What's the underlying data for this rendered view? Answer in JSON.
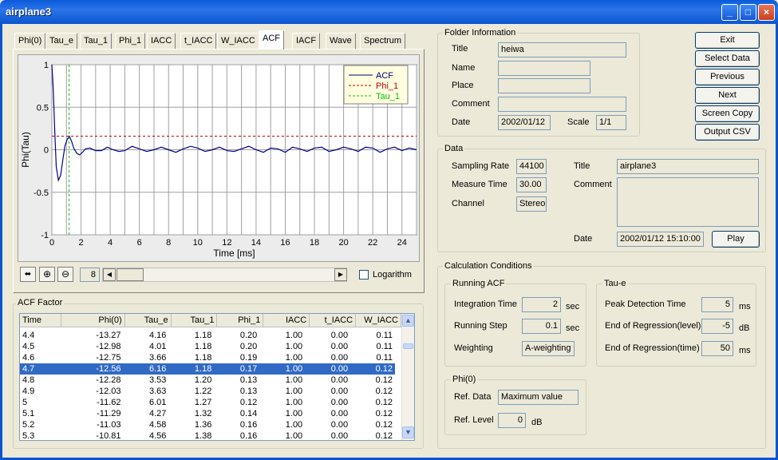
{
  "window": {
    "title": "airplane3"
  },
  "tabs": [
    "Phi(0)",
    "Tau_e",
    "Tau_1",
    "Phi_1",
    "IACC",
    "t_IACC",
    "W_IACC",
    "ACF",
    "IACF",
    "Wave",
    "Spectrum"
  ],
  "selected_tab": "ACF",
  "chart_data": {
    "type": "line",
    "xlabel": "Time [ms]",
    "ylabel": "Phi(Tau)",
    "xlim": [
      0,
      25
    ],
    "ylim": [
      -1,
      1
    ],
    "xticks": [
      0,
      2,
      4,
      6,
      8,
      10,
      12,
      14,
      16,
      18,
      20,
      22,
      24
    ],
    "yticks": [
      1,
      0.5,
      0,
      -0.5,
      -1
    ],
    "ytick_labels": [
      "1",
      "0.5",
      "0",
      "-0.5",
      "-1"
    ],
    "legend": "top-right",
    "series": [
      {
        "name": "ACF",
        "color": "#000080",
        "x": [
          0,
          0.1,
          0.2,
          0.3,
          0.45,
          0.6,
          0.75,
          0.9,
          1.05,
          1.2,
          1.35,
          1.5,
          1.7,
          1.9,
          2.1,
          2.3,
          2.6,
          3.0,
          3.4,
          3.8,
          4.2,
          4.6,
          5.0,
          5.5,
          6.0,
          6.5,
          7.0,
          7.5,
          8.0,
          8.5,
          9.0,
          9.5,
          10.0,
          10.5,
          11.0,
          11.5,
          12.0,
          12.5,
          13.0,
          13.5,
          14.0,
          14.5,
          15.0,
          15.5,
          16.0,
          16.5,
          17.0,
          17.5,
          18.0,
          18.5,
          19.0,
          19.5,
          20.0,
          20.5,
          21.0,
          21.5,
          22.0,
          22.5,
          23.0,
          23.5,
          24.0,
          24.5,
          25.0
        ],
        "y": [
          1.0,
          0.7,
          0.2,
          -0.2,
          -0.36,
          -0.3,
          -0.12,
          0.05,
          0.12,
          0.16,
          0.1,
          0.02,
          -0.04,
          -0.06,
          -0.03,
          0.01,
          0.02,
          -0.01,
          -0.01,
          0.03,
          0.0,
          -0.02,
          -0.01,
          0.04,
          0.01,
          -0.02,
          0.0,
          0.03,
          0.0,
          -0.03,
          0.01,
          0.04,
          0.02,
          -0.02,
          0.0,
          0.03,
          -0.01,
          -0.02,
          0.01,
          0.04,
          0.0,
          -0.03,
          0.02,
          0.01,
          -0.03,
          0.03,
          0.01,
          -0.02,
          0.02,
          0.03,
          -0.02,
          0.0,
          0.03,
          0.01,
          -0.02,
          0.03,
          0.02,
          -0.03,
          0.01,
          0.03,
          -0.01,
          0.02,
          0.0
        ]
      },
      {
        "name": "Phi_1",
        "color": "#c00000",
        "style": "dashed",
        "y_const": 0.16
      },
      {
        "name": "Tau_1",
        "color": "#00c000",
        "style": "dashed",
        "x_const": 1.18
      }
    ]
  },
  "toolbar": {
    "page_value": "8",
    "log_label": "Logarithm",
    "log_checked": false
  },
  "acf_factor": {
    "title": "ACF Factor",
    "columns": [
      "Time",
      "Phi(0)",
      "Tau_e",
      "Tau_1",
      "Phi_1",
      "IACC",
      "t_IACC",
      "W_IACC"
    ],
    "rows": [
      [
        "4.4",
        "-13.27",
        "4.16",
        "1.18",
        "0.20",
        "1.00",
        "0.00",
        "0.11"
      ],
      [
        "4.5",
        "-12.98",
        "4.01",
        "1.18",
        "0.20",
        "1.00",
        "0.00",
        "0.11"
      ],
      [
        "4.6",
        "-12.75",
        "3.66",
        "1.18",
        "0.19",
        "1.00",
        "0.00",
        "0.11"
      ],
      [
        "4.7",
        "-12.56",
        "6.16",
        "1.18",
        "0.17",
        "1.00",
        "0.00",
        "0.12"
      ],
      [
        "4.8",
        "-12.28",
        "3.53",
        "1.20",
        "0.13",
        "1.00",
        "0.00",
        "0.12"
      ],
      [
        "4.9",
        "-12.03",
        "3.63",
        "1.22",
        "0.13",
        "1.00",
        "0.00",
        "0.12"
      ],
      [
        "5",
        "-11.62",
        "6.01",
        "1.27",
        "0.12",
        "1.00",
        "0.00",
        "0.12"
      ],
      [
        "5.1",
        "-11.29",
        "4.27",
        "1.32",
        "0.14",
        "1.00",
        "0.00",
        "0.12"
      ],
      [
        "5.2",
        "-11.03",
        "4.58",
        "1.36",
        "0.16",
        "1.00",
        "0.00",
        "0.12"
      ],
      [
        "5.3",
        "-10.81",
        "4.56",
        "1.38",
        "0.16",
        "1.00",
        "0.00",
        "0.12"
      ]
    ],
    "selected_row": 3
  },
  "folder_info": {
    "title": "Folder Information",
    "title_label": "Title",
    "title_value": "heiwa",
    "name_label": "Name",
    "name_value": "",
    "place_label": "Place",
    "place_value": "",
    "comment_label": "Comment",
    "comment_value": "",
    "date_label": "Date",
    "date_value": "2002/01/12",
    "scale_label": "Scale",
    "scale_value": "1/1"
  },
  "buttons": {
    "exit": "Exit",
    "select_data": "Select Data",
    "previous": "Previous",
    "next": "Next",
    "screen_copy": "Screen Copy",
    "output_csv": "Output CSV",
    "play": "Play"
  },
  "data_group": {
    "title": "Data",
    "sampling_rate_label": "Sampling Rate",
    "sampling_rate": "44100",
    "measure_time_label": "Measure Time",
    "measure_time": "30.00",
    "channel_label": "Channel",
    "channel": "Stereo",
    "title_label": "Title",
    "title_value": "airplane3",
    "comment_label": "Comment",
    "comment_value": "",
    "date_label": "Date",
    "date_value": "2002/01/12 15:10:00"
  },
  "calc": {
    "title": "Calculation Conditions",
    "running_acf": {
      "title": "Running ACF",
      "integration_time_label": "Integration Time",
      "integration_time": "2",
      "integration_unit": "sec",
      "running_step_label": "Running Step",
      "running_step": "0.1",
      "running_step_unit": "sec",
      "weighting_label": "Weighting",
      "weighting": "A-weighting"
    },
    "tau_e": {
      "title": "Tau-e",
      "peak_label": "Peak Detection Time",
      "peak": "5",
      "peak_unit": "ms",
      "eor_level_label": "End of Regression(level)",
      "eor_level": "-5",
      "eor_level_unit": "dB",
      "eor_time_label": "End of Regression(time)",
      "eor_time": "50",
      "eor_time_unit": "ms"
    },
    "phi0": {
      "title": "Phi(0)",
      "ref_data_label": "Ref. Data",
      "ref_data": "Maximum value",
      "ref_level_label": "Ref. Level",
      "ref_level": "0",
      "ref_level_unit": "dB"
    }
  }
}
